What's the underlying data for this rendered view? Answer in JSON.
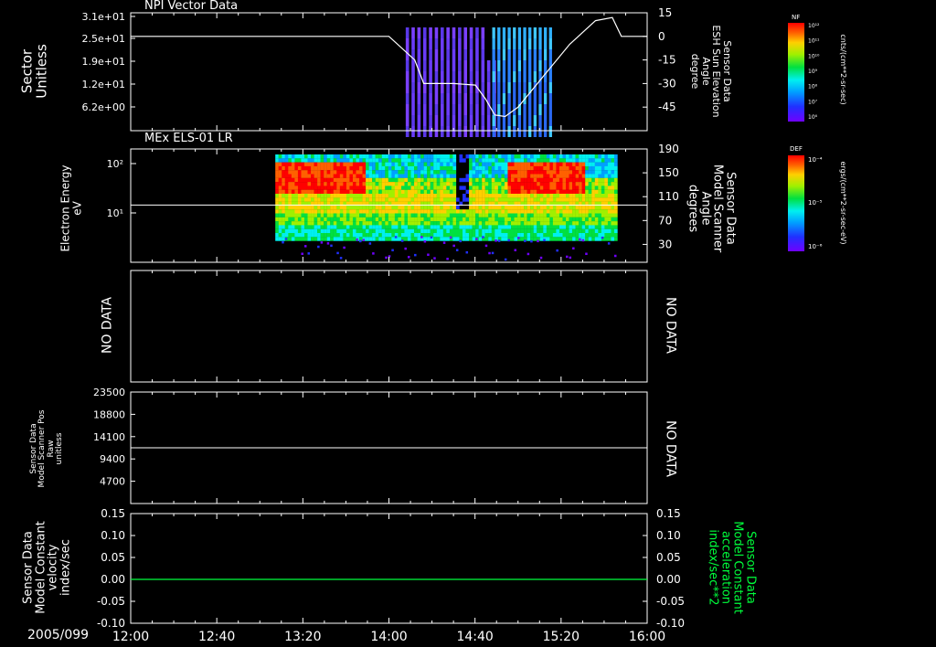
{
  "date_label": "2005/099",
  "colors": {
    "trace": "#ffffff",
    "green_trace": "#00ff3c"
  },
  "panel1": {
    "title": "NPI Vector Data",
    "ylabel_line1": "Sector",
    "ylabel_line2": "Unitless",
    "right_label": [
      "Sensor Data",
      "ESH Sun Elevation",
      "Angle",
      "degree"
    ],
    "colorbar_title": "NF",
    "colorbar_units": "cnts/(cm**2-sr-sec)",
    "colorbar_ticks": [
      "10¹²",
      "10¹¹",
      "10¹⁰",
      "10⁹",
      "10⁸",
      "10⁷",
      "10⁶"
    ]
  },
  "panel2": {
    "title": "MEx ELS-01 LR",
    "ylabel_line1": "Electron Energy",
    "ylabel_line2": "eV",
    "right_label": [
      "Sensor Data",
      "Model Scanner",
      "Angle",
      "degrees"
    ],
    "colorbar_title": "DEF",
    "colorbar_units": "ergs/(cm**2-sr-sec-eV)",
    "colorbar_ticks": [
      "10⁻⁴",
      "10⁻⁵",
      "10⁻⁶"
    ]
  },
  "panel3": {
    "left_label": "NO DATA",
    "right_label": "NO DATA"
  },
  "panel4": {
    "ylabel": [
      "Sensor Data",
      "Model Scanner Pos",
      "Raw",
      "unitless"
    ],
    "right_label": "NO DATA"
  },
  "panel5": {
    "ylabel": [
      "Sensor Data",
      "Model Constant",
      "velocity",
      "index/sec"
    ],
    "right_label": [
      "Sensor Data",
      "Model Constant",
      "acceleration",
      "index/sec**2"
    ]
  },
  "chart_data": [
    {
      "type": "heatmap",
      "title": "NPI Vector Data",
      "xlabel": "",
      "ylabel": "Sector Unitless",
      "x_ticks": [
        "12:00",
        "12:40",
        "13:20",
        "14:00",
        "14:40",
        "15:20",
        "16:00"
      ],
      "y_ticks": [
        "3.1e+01",
        "2.5e+01",
        "1.9e+01",
        "1.2e+01",
        "6.2e+00"
      ],
      "y2_ticks": [
        "15",
        "0",
        "-15",
        "-30",
        "-45"
      ],
      "y2lim": [
        -60,
        15
      ],
      "line_series": {
        "name": "ESH Sun Elevation Angle",
        "x_hours": [
          12.0,
          13.0,
          14.0,
          14.2,
          14.27,
          14.35,
          14.5,
          14.67,
          14.75,
          14.82,
          14.9,
          15.0,
          15.2,
          15.4,
          15.6,
          15.73,
          15.8,
          16.0
        ],
        "y": [
          0,
          0,
          0,
          -15,
          -30,
          -30,
          -30,
          -31,
          -40,
          -50,
          -51,
          -45,
          -25,
          -5,
          10,
          12,
          0,
          0
        ]
      }
    },
    {
      "type": "heatmap",
      "title": "MEx ELS-01 LR",
      "ylabel": "Electron Energy eV",
      "y_ticks": [
        "10²",
        "10¹"
      ],
      "y2_ticks": [
        "190",
        "150",
        "110",
        "70",
        "30"
      ],
      "y2lim": [
        0,
        190
      ],
      "line_series": {
        "name": "Model Scanner Angle",
        "x_hours": [
          12.0,
          16.0
        ],
        "y": [
          96,
          96
        ]
      }
    },
    {
      "type": "line",
      "ylabel": "Sensor Data Model Scanner Pos Raw unitless",
      "y_ticks": [
        "23500",
        "18800",
        "14100",
        "9400",
        "4700"
      ],
      "ylim": [
        0,
        23500
      ],
      "series": [
        {
          "x_hours": [
            12.0,
            16.0
          ],
          "values": [
            11750,
            11750
          ]
        }
      ]
    },
    {
      "type": "line",
      "ylabel": "Sensor Data Model Constant velocity index/sec",
      "y_ticks": [
        "0.15",
        "0.10",
        "0.05",
        "0.00",
        "-0.05",
        "-0.10"
      ],
      "y2_ticks": [
        "0.15",
        "0.10",
        "0.05",
        "0.00",
        "-0.05",
        "-0.10"
      ],
      "ylim": [
        -0.1,
        0.15
      ],
      "series": [
        {
          "x_hours": [
            12.0,
            16.0
          ],
          "values": [
            0,
            0
          ]
        }
      ]
    }
  ]
}
